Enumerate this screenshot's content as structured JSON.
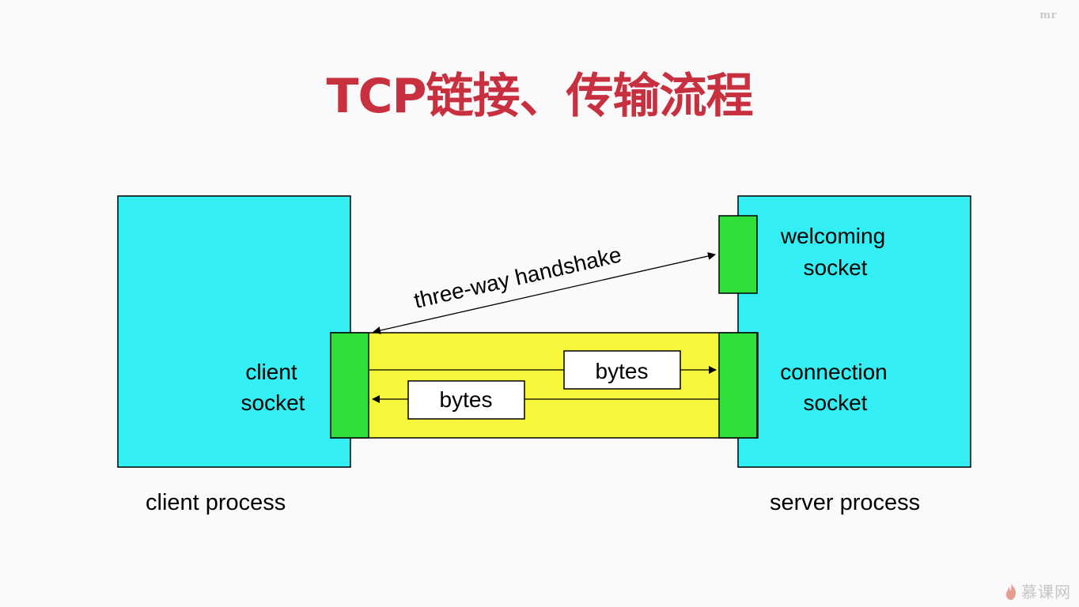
{
  "slide": {
    "title": "TCP链接、传输流程",
    "corner_mark": "mr",
    "watermark": "慕课网"
  },
  "diagram": {
    "labels": {
      "client_socket_line1": "client",
      "client_socket_line2": "socket",
      "welcoming_socket_line1": "welcoming",
      "welcoming_socket_line2": "socket",
      "connection_socket_line1": "connection",
      "connection_socket_line2": "socket",
      "handshake": "three-way handshake",
      "bytes_to_server": "bytes",
      "bytes_to_client": "bytes",
      "client_process": "client process",
      "server_process": "server process"
    },
    "colors": {
      "title": "#c8303f",
      "process_box": "#33eef2",
      "socket": "#2fe03a",
      "connection_pipe": "#f6f63a",
      "byte_box": "#ffffff",
      "outline": "#000000"
    }
  }
}
